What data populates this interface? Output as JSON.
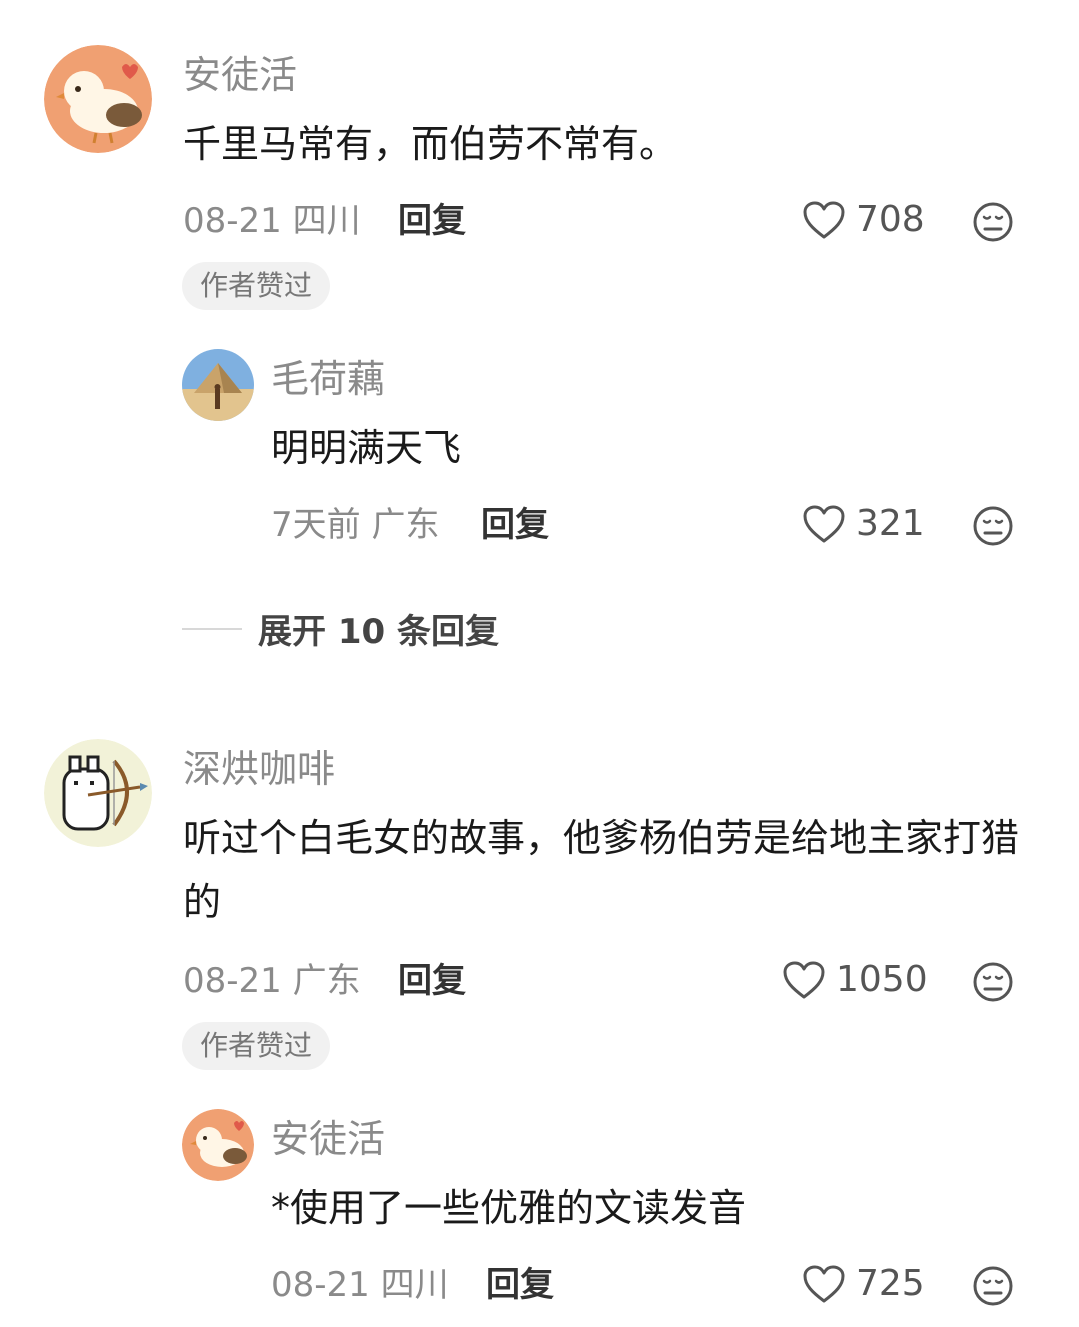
{
  "comments": [
    {
      "name": "安徒活",
      "text": "千里马常有，而伯劳不常有。",
      "date": "08-21",
      "location": "四川",
      "reply_label": "回复",
      "likes": "708",
      "badge": "作者赞过",
      "sub_replies": [
        {
          "name": "毛荷藕",
          "text": "明明满天飞",
          "date": "7天前",
          "location": "广东",
          "reply_label": "回复",
          "likes": "321"
        }
      ],
      "expand_label": "展开 10 条回复"
    },
    {
      "name": "深烘咖啡",
      "text": "听过个白毛女的故事，他爹杨伯劳是给地主家打猎的",
      "date": "08-21",
      "location": "广东",
      "reply_label": "回复",
      "likes": "1050",
      "badge": "作者赞过",
      "sub_replies": [
        {
          "name": "安徒活",
          "text": "*使用了一些优雅的文读发音",
          "date": "08-21",
          "location": "四川",
          "reply_label": "回复",
          "likes": "725"
        }
      ]
    }
  ],
  "icons": {
    "like": "heart-outline-icon",
    "emoji": "neutral-face-icon"
  },
  "colors": {
    "name_gray": "#8a8a8a",
    "badge_bg": "#f1f1f1",
    "avatar_peach": "#f0a072"
  }
}
